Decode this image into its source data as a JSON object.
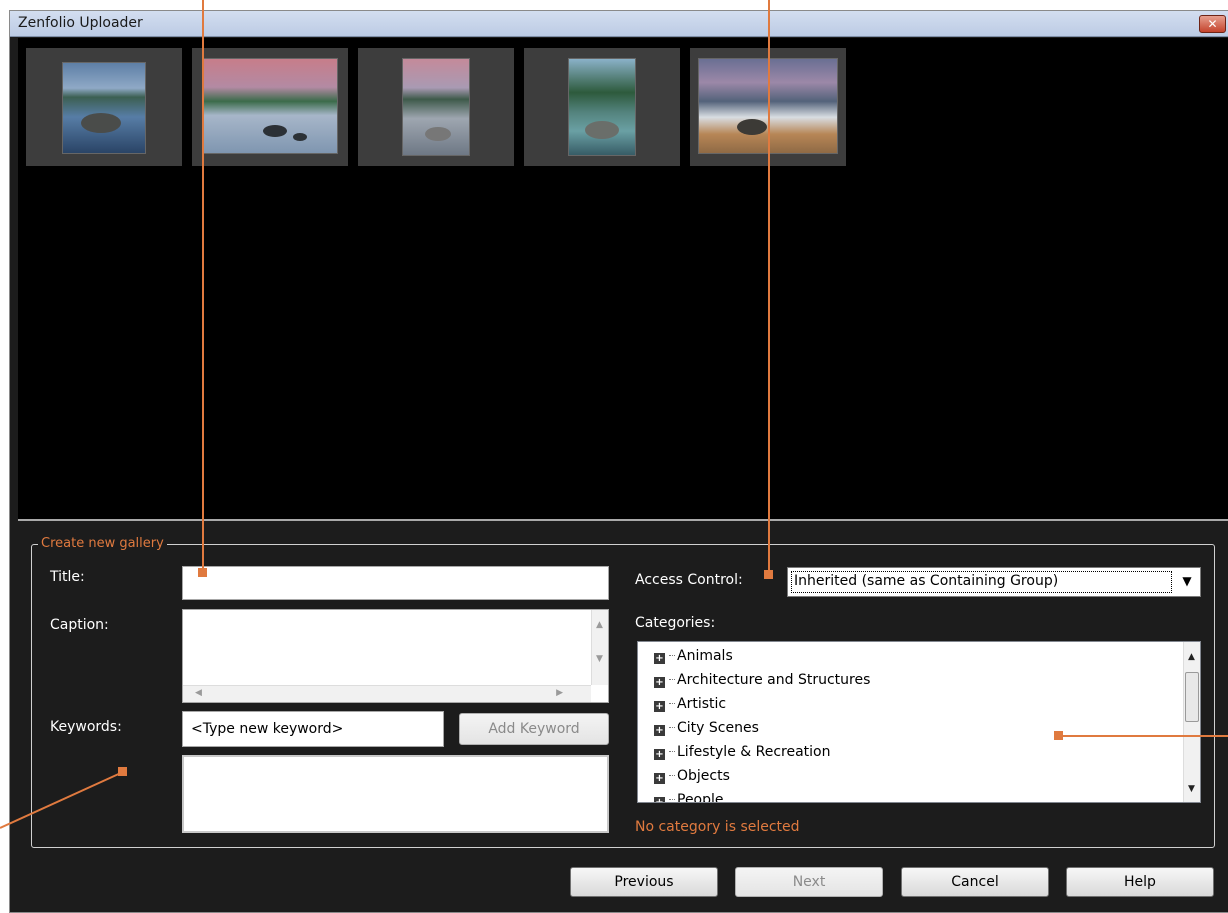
{
  "window": {
    "title": "Zenfolio Uploader",
    "close_glyph": "✕"
  },
  "gallery": {
    "legend": "Create new gallery",
    "title_label": "Title:",
    "title_value": "",
    "caption_label": "Caption:",
    "caption_value": "",
    "keywords_label": "Keywords:",
    "keyword_placeholder": "<Type new keyword>",
    "add_keyword_label": "Add Keyword",
    "access_label": "Access Control:",
    "access_value": "Inherited (same as Containing Group)",
    "categories_label": "Categories:",
    "categories": [
      "Animals",
      "Architecture and Structures",
      "Artistic",
      "City Scenes",
      "Lifestyle & Recreation",
      "Objects",
      "People"
    ],
    "category_status": "No category is selected"
  },
  "buttons": {
    "previous": "Previous",
    "next": "Next",
    "cancel": "Cancel",
    "help": "Help"
  },
  "colors": {
    "accent": "#e07a3f",
    "window_bg": "#1c1c1c",
    "thumb_area_bg": "#000000"
  },
  "icons": {
    "close": "close-icon",
    "dropdown": "chevron-down-icon",
    "expand": "plus-box-icon"
  }
}
